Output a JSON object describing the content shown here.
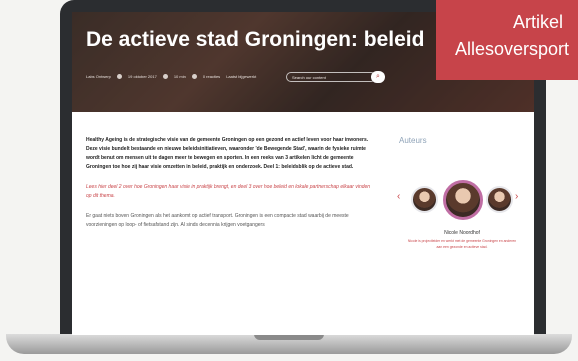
{
  "article": {
    "title": "De actieve stad Groningen: beleid",
    "meta": {
      "category": "Labs Ontwerp",
      "date": "19 oktober 2017",
      "read_time": "10 min",
      "comments": "0 reacties",
      "views": "Laatst bijgewerkt"
    },
    "search_placeholder": "Search our content",
    "intro": "Healthy Ageing is de strategische visie van de gemeente Groningen op een gezond en actief leven voor haar inwoners. Deze visie bundelt bestaande en nieuwe beleidsinitiatieven, waaronder 'de Bewegende Stad', waarin de fysieke ruimte wordt benut om mensen uit te dagen meer te bewegen en sporten. In een reeks van 3 artikelen licht de gemeente Groningen toe hoe zij haar visie omzetten in beleid, praktijk en onderzoek. Deel 1: beleidsblik op de actieve stad.",
    "links": "Lees hier deel 2 over hoe Groningen haar visie in praktijk brengt, en deel 3 over hoe beleid en lokale partnerschap elkaar vinden op dit thema.",
    "body": "Er gaat niets boven Groningen als het aankomt op actief transport. Groningen is een compacte stad waarbij de meeste voorzieningen op loop- of fietsafstand zijn. Al sinds decennia krijgen voetgangers"
  },
  "sidebar": {
    "title": "Auteurs",
    "author_name": "Nicole Noordhof",
    "bio": "Nicole is projectleider en werkt met de gemeente Groningen en anderen aan een gezonde en actieve stad."
  },
  "banner": {
    "line1": "Artikel",
    "line2": "Allesoversport"
  },
  "colors": {
    "accent": "#c7444a",
    "sidebar_title": "#8fa3b8",
    "link": "#c9464a"
  }
}
